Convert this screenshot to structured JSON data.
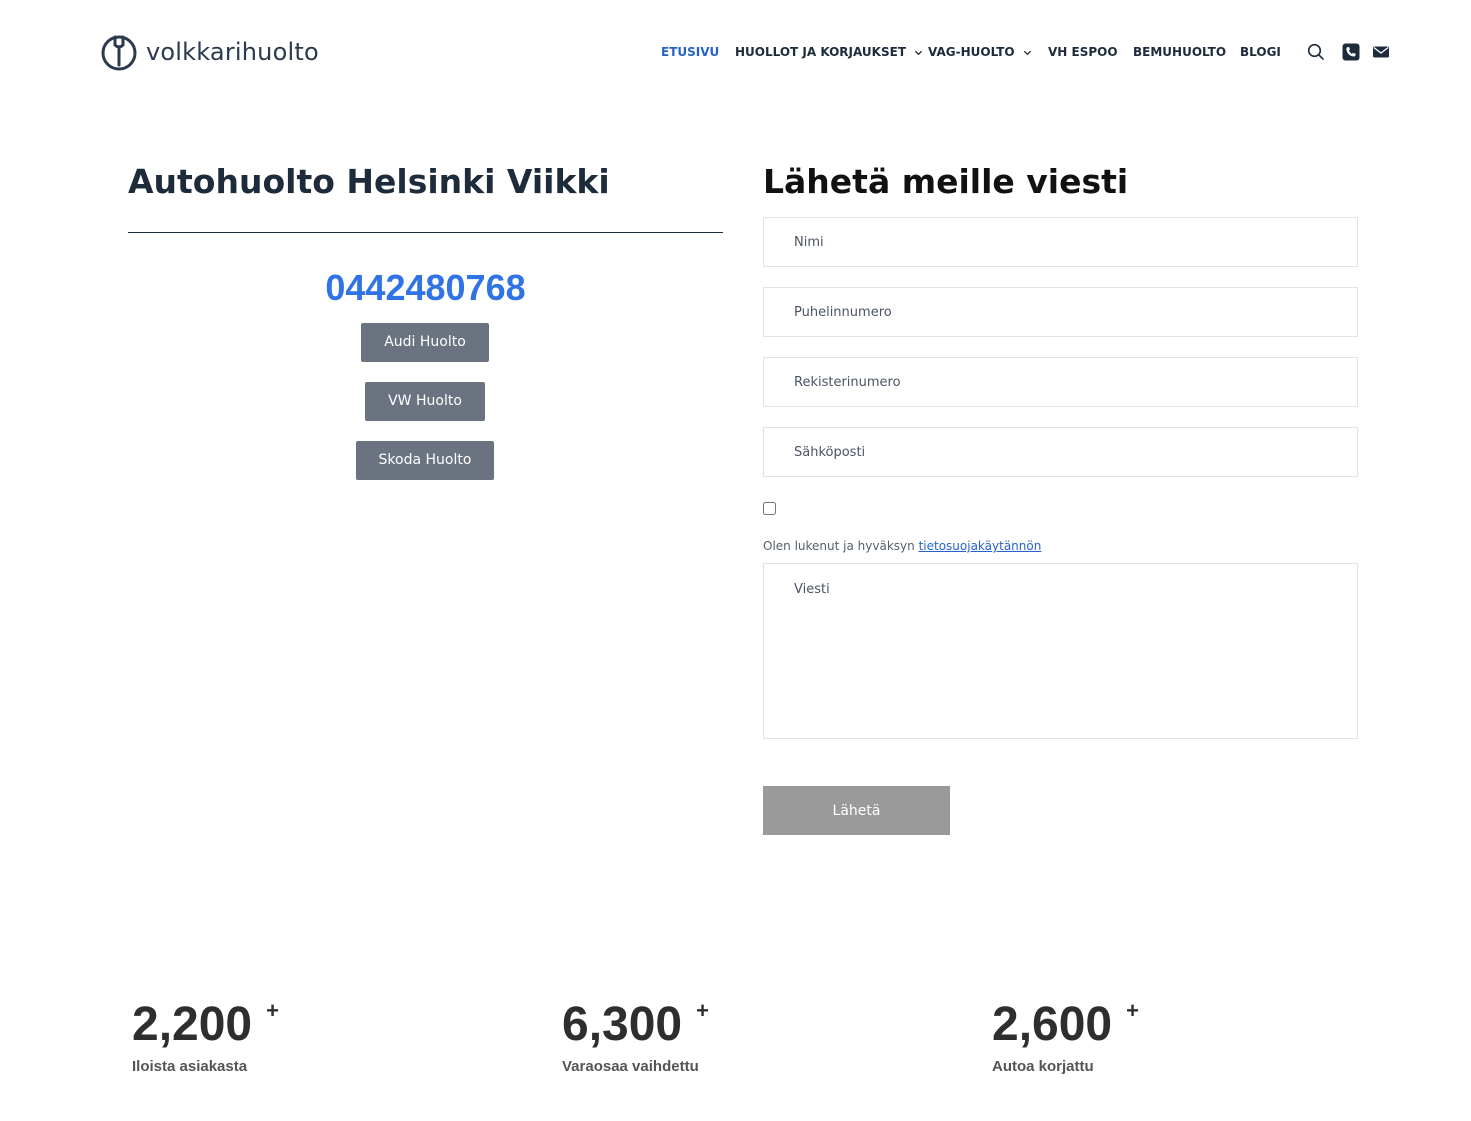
{
  "header": {
    "logo_text": "volkkarihuolto",
    "nav": [
      {
        "label": "ETUSIVU",
        "active": true
      },
      {
        "label": "HUOLLOT JA KORJAUKSET",
        "dropdown": true
      },
      {
        "label": "VAG-HUOLTO",
        "dropdown": true
      },
      {
        "label": "VH ESPOO"
      },
      {
        "label": "BEMUHUOLTO"
      },
      {
        "label": "BLOGI"
      }
    ],
    "icons": [
      "search-icon",
      "phone-icon",
      "mail-icon"
    ]
  },
  "location": {
    "title": "Autohuolto Helsinki Viikki",
    "phone": "0442480768",
    "buttons": [
      "Audi Huolto",
      "VW Huolto",
      "Skoda Huolto"
    ]
  },
  "contact_form": {
    "title": "Lähetä meille viesti",
    "fields": {
      "name_placeholder": "Nimi",
      "phone_placeholder": "Puhelinnumero",
      "registration_placeholder": "Rekisterinumero",
      "email_placeholder": "Sähköposti",
      "message_placeholder": "Viesti"
    },
    "consent_checked": false,
    "consent_text": "Olen lukenut ja hyväksyn",
    "consent_link": "tietosuojakäytännön",
    "submit_label": "Lähetä"
  },
  "stats": [
    {
      "value": "2,200",
      "suffix": "+",
      "label": "Iloista asiakasta"
    },
    {
      "value": "6,300",
      "suffix": "+",
      "label": "Varaosaa vaihdettu"
    },
    {
      "value": "2,600",
      "suffix": "+",
      "label": "Autoa korjattu"
    }
  ],
  "colors": {
    "accent": "#2563c9",
    "phone": "#2f73e6",
    "text_dark": "#1d2b3a",
    "button_gray": "#6c7380",
    "submit_gray": "#9a9a9a"
  }
}
